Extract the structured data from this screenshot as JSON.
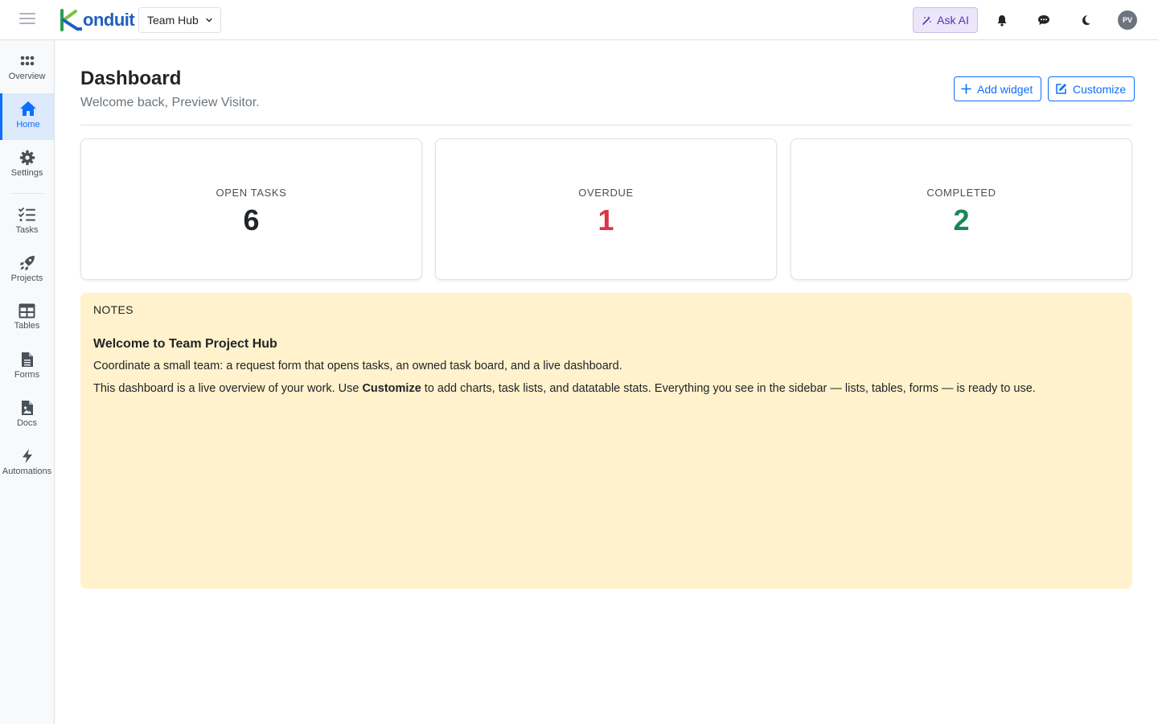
{
  "header": {
    "logo_text": "onduit",
    "workspace_label": "Team Hub",
    "ask_ai_label": "Ask AI",
    "avatar_initials": "PV"
  },
  "sidebar": {
    "items": [
      {
        "label": "Overview",
        "icon": "grid-dots-icon"
      },
      {
        "label": "Home",
        "icon": "home-icon",
        "active": true
      },
      {
        "label": "Settings",
        "icon": "gear-icon"
      },
      {
        "label": "Tasks",
        "icon": "task-list-icon"
      },
      {
        "label": "Projects",
        "icon": "rocket-icon"
      },
      {
        "label": "Tables",
        "icon": "table-icon"
      },
      {
        "label": "Forms",
        "icon": "document-icon"
      },
      {
        "label": "Docs",
        "icon": "doc-image-icon"
      },
      {
        "label": "Automations",
        "icon": "lightning-icon"
      }
    ]
  },
  "page": {
    "title": "Dashboard",
    "subtitle": "Welcome back, Preview Visitor.",
    "add_widget_label": "Add widget",
    "customize_label": "Customize"
  },
  "stats": [
    {
      "label": "OPEN TASKS",
      "value": "6",
      "color": "#212529"
    },
    {
      "label": "OVERDUE",
      "value": "1",
      "color": "#dc3545"
    },
    {
      "label": "COMPLETED",
      "value": "2",
      "color": "#198754"
    }
  ],
  "notes": {
    "heading": "NOTES",
    "title": "Welcome to Team Project Hub",
    "para1": "Coordinate a small team: a request form that opens tasks, an owned task board, and a live dashboard.",
    "para2_pre": "This dashboard is a live overview of your work. Use ",
    "para2_bold": "Customize",
    "para2_post": " to add charts, task lists, and datatable stats. Everything you see in the sidebar — lists, tables, forms — is ready to use."
  },
  "colors": {
    "accent": "#0d6efd",
    "notes_bg": "#fff2cc",
    "overdue": "#dc3545",
    "completed": "#198754"
  }
}
